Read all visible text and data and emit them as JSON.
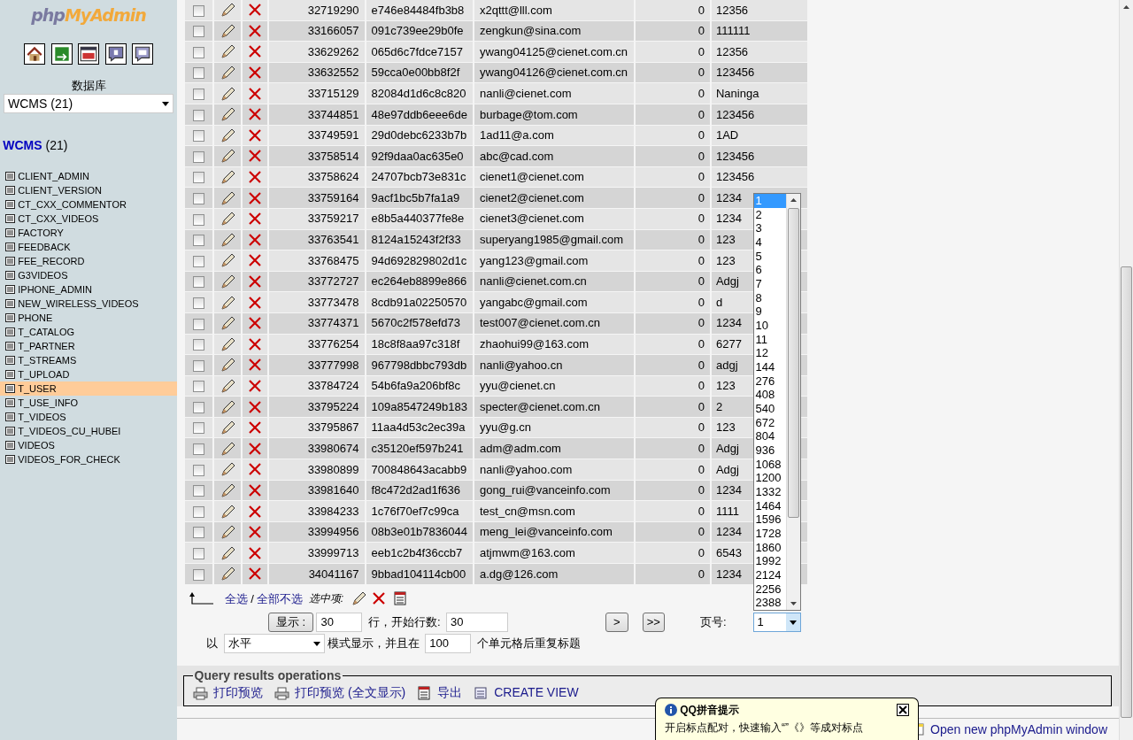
{
  "sidebar": {
    "logo": {
      "part1": "php",
      "part2": "MyAdmin"
    },
    "db_label": "数据库",
    "db_select": "WCMS (21)",
    "db_title": "WCMS",
    "db_count": "(21)",
    "tables": [
      {
        "name": "CLIENT_ADMIN",
        "selected": false
      },
      {
        "name": "CLIENT_VERSION",
        "selected": false
      },
      {
        "name": "CT_CXX_COMMENTOR",
        "selected": false
      },
      {
        "name": "CT_CXX_VIDEOS",
        "selected": false
      },
      {
        "name": "FACTORY",
        "selected": false
      },
      {
        "name": "FEEDBACK",
        "selected": false
      },
      {
        "name": "FEE_RECORD",
        "selected": false
      },
      {
        "name": "G3VIDEOS",
        "selected": false
      },
      {
        "name": "IPHONE_ADMIN",
        "selected": false
      },
      {
        "name": "NEW_WIRELESS_VIDEOS",
        "selected": false
      },
      {
        "name": "PHONE",
        "selected": false
      },
      {
        "name": "T_CATALOG",
        "selected": false
      },
      {
        "name": "T_PARTNER",
        "selected": false
      },
      {
        "name": "T_STREAMS",
        "selected": false
      },
      {
        "name": "T_UPLOAD",
        "selected": false
      },
      {
        "name": "T_USER",
        "selected": true
      },
      {
        "name": "T_USE_INFO",
        "selected": false
      },
      {
        "name": "T_VIDEOS",
        "selected": false
      },
      {
        "name": "T_VIDEOS_CU_HUBEI",
        "selected": false
      },
      {
        "name": "VIDEOS",
        "selected": false
      },
      {
        "name": "VIDEOS_FOR_CHECK",
        "selected": false
      }
    ]
  },
  "table": {
    "rows": [
      {
        "checked": false,
        "id": "32719290",
        "hash": "e746e84484fb3b8",
        "email": "x2qttt@lll.com",
        "flag": "0",
        "password": "12356"
      },
      {
        "checked": false,
        "id": "33166057",
        "hash": "091c739ee29b0fe",
        "email": "zengkun@sina.com",
        "flag": "0",
        "password": "111111"
      },
      {
        "checked": false,
        "id": "33629262",
        "hash": "065d6c7fdce7157",
        "email": "ywang04125@cienet.com.cn",
        "flag": "0",
        "password": "12356"
      },
      {
        "checked": false,
        "id": "33632552",
        "hash": "59cca0e00bb8f2f",
        "email": "ywang04126@cienet.com.cn",
        "flag": "0",
        "password": "123456"
      },
      {
        "checked": false,
        "id": "33715129",
        "hash": "82084d1d6c8c820",
        "email": "nanli@cienet.com",
        "flag": "0",
        "password": "Naninga"
      },
      {
        "checked": false,
        "id": "33744851",
        "hash": "48e97ddb6eee6de",
        "email": "burbage@tom.com",
        "flag": "0",
        "password": "123456"
      },
      {
        "checked": false,
        "id": "33749591",
        "hash": "29d0debc6233b7b",
        "email": "1ad11@a.com",
        "flag": "0",
        "password": "1AD"
      },
      {
        "checked": false,
        "id": "33758514",
        "hash": "92f9daa0ac635e0",
        "email": "abc@cad.com",
        "flag": "0",
        "password": "123456"
      },
      {
        "checked": false,
        "id": "33758624",
        "hash": "24707bcb73e831c",
        "email": "cienet1@cienet.com",
        "flag": "0",
        "password": "123456"
      },
      {
        "checked": false,
        "id": "33759164",
        "hash": "9acf1bc5b7fa1a9",
        "email": "cienet2@cienet.com",
        "flag": "0",
        "password": "1234"
      },
      {
        "checked": false,
        "id": "33759217",
        "hash": "e8b5a440377fe8e",
        "email": "cienet3@cienet.com",
        "flag": "0",
        "password": "1234"
      },
      {
        "checked": false,
        "id": "33763541",
        "hash": "8124a15243f2f33",
        "email": "superyang1985@gmail.com",
        "flag": "0",
        "password": "123"
      },
      {
        "checked": false,
        "id": "33768475",
        "hash": "94d692829802d1c",
        "email": "yang123@gmail.com",
        "flag": "0",
        "password": "123"
      },
      {
        "checked": false,
        "id": "33772727",
        "hash": "ec264eb8899e866",
        "email": "nanli@cienet.com.cn",
        "flag": "0",
        "password": "Adgj"
      },
      {
        "checked": false,
        "id": "33773478",
        "hash": "8cdb91a02250570",
        "email": "yangabc@gmail.com",
        "flag": "0",
        "password": "d"
      },
      {
        "checked": false,
        "id": "33774371",
        "hash": "5670c2f578efd73",
        "email": "test007@cienet.com.cn",
        "flag": "0",
        "password": "1234"
      },
      {
        "checked": false,
        "id": "33776254",
        "hash": "18c8f8aa97c318f",
        "email": "zhaohui99@163.com",
        "flag": "0",
        "password": "6277"
      },
      {
        "checked": false,
        "id": "33777998",
        "hash": "967798dbbc793db",
        "email": "nanli@yahoo.cn",
        "flag": "0",
        "password": "adgj"
      },
      {
        "checked": false,
        "id": "33784724",
        "hash": "54b6fa9a206bf8c",
        "email": "yyu@cienet.cn",
        "flag": "0",
        "password": "123"
      },
      {
        "checked": false,
        "id": "33795224",
        "hash": "109a8547249b183",
        "email": "specter@cienet.com.cn",
        "flag": "0",
        "password": "2"
      },
      {
        "checked": false,
        "id": "33795867",
        "hash": "11aa4d53c2ec39a",
        "email": "yyu@g.cn",
        "flag": "0",
        "password": "123"
      },
      {
        "checked": false,
        "id": "33980674",
        "hash": "c35120ef597b241",
        "email": "adm@adm.com",
        "flag": "0",
        "password": "Adgj"
      },
      {
        "checked": false,
        "id": "33980899",
        "hash": "700848643acabb9",
        "email": "nanli@yahoo.com",
        "flag": "0",
        "password": "Adgj"
      },
      {
        "checked": false,
        "id": "33981640",
        "hash": "f8c472d2ad1f636",
        "email": "gong_rui@vanceinfo.com",
        "flag": "0",
        "password": "1234"
      },
      {
        "checked": false,
        "id": "33984233",
        "hash": "1c76f70ef7c99ca",
        "email": "test_cn@msn.com",
        "flag": "0",
        "password": "1111"
      },
      {
        "checked": false,
        "id": "33994956",
        "hash": "08b3e01b7836044",
        "email": "meng_lei@vanceinfo.com",
        "flag": "0",
        "password": "1234"
      },
      {
        "checked": false,
        "id": "33999713",
        "hash": "eeb1c2b4f36ccb7",
        "email": "atjmwm@163.com",
        "flag": "0",
        "password": "6543"
      },
      {
        "checked": false,
        "id": "34041167",
        "hash": "9bbad104114cb00",
        "email": "a.dg@126.com",
        "flag": "0",
        "password": "1234"
      }
    ]
  },
  "selection_bar": {
    "check_all": "全选",
    "separator": "/",
    "uncheck_all": "全部不选",
    "with_selected": "选中项:"
  },
  "navigation": {
    "show_button": "显示 :",
    "rows": "30",
    "rows_label": "行，开始行数:",
    "start": "30",
    "next": ">",
    "last": ">>",
    "page_label": "页号:",
    "page": "1",
    "page_options": [
      {
        "label": "1",
        "selected": true
      },
      {
        "label": "2",
        "selected": false
      },
      {
        "label": "3",
        "selected": false
      },
      {
        "label": "4",
        "selected": false
      },
      {
        "label": "5",
        "selected": false
      },
      {
        "label": "6",
        "selected": false
      },
      {
        "label": "7",
        "selected": false
      },
      {
        "label": "8",
        "selected": false
      },
      {
        "label": "9",
        "selected": false
      },
      {
        "label": "10",
        "selected": false
      },
      {
        "label": "11",
        "selected": false
      },
      {
        "label": "12",
        "selected": false
      },
      {
        "label": "144",
        "selected": false
      },
      {
        "label": "276",
        "selected": false
      },
      {
        "label": "408",
        "selected": false
      },
      {
        "label": "540",
        "selected": false
      },
      {
        "label": "672",
        "selected": false
      },
      {
        "label": "804",
        "selected": false
      },
      {
        "label": "936",
        "selected": false
      },
      {
        "label": "1068",
        "selected": false
      },
      {
        "label": "1200",
        "selected": false
      },
      {
        "label": "1332",
        "selected": false
      },
      {
        "label": "1464",
        "selected": false
      },
      {
        "label": "1596",
        "selected": false
      },
      {
        "label": "1728",
        "selected": false
      },
      {
        "label": "1860",
        "selected": false
      },
      {
        "label": "1992",
        "selected": false
      },
      {
        "label": "2124",
        "selected": false
      },
      {
        "label": "2256",
        "selected": false
      },
      {
        "label": "2388",
        "selected": false
      }
    ]
  },
  "display": {
    "prefix": "以",
    "mode": "水平",
    "mode_label": "模式显示，并且在",
    "repeat": "100",
    "repeat_label": "个单元格后重复标题"
  },
  "query_ops": {
    "legend": "Query results operations",
    "links": [
      {
        "kind": "print",
        "label": "打印预览"
      },
      {
        "kind": "print",
        "label": "打印预览 (全文显示)"
      },
      {
        "kind": "export",
        "label": "导出"
      },
      {
        "kind": "view",
        "label": "CREATE VIEW"
      }
    ]
  },
  "footer": {
    "new_window": "Open new phpMyAdmin window"
  },
  "ime_popup": {
    "title": "QQ拼音提示",
    "message": "开启标点配对，快速输入“”《》等成对标点"
  }
}
